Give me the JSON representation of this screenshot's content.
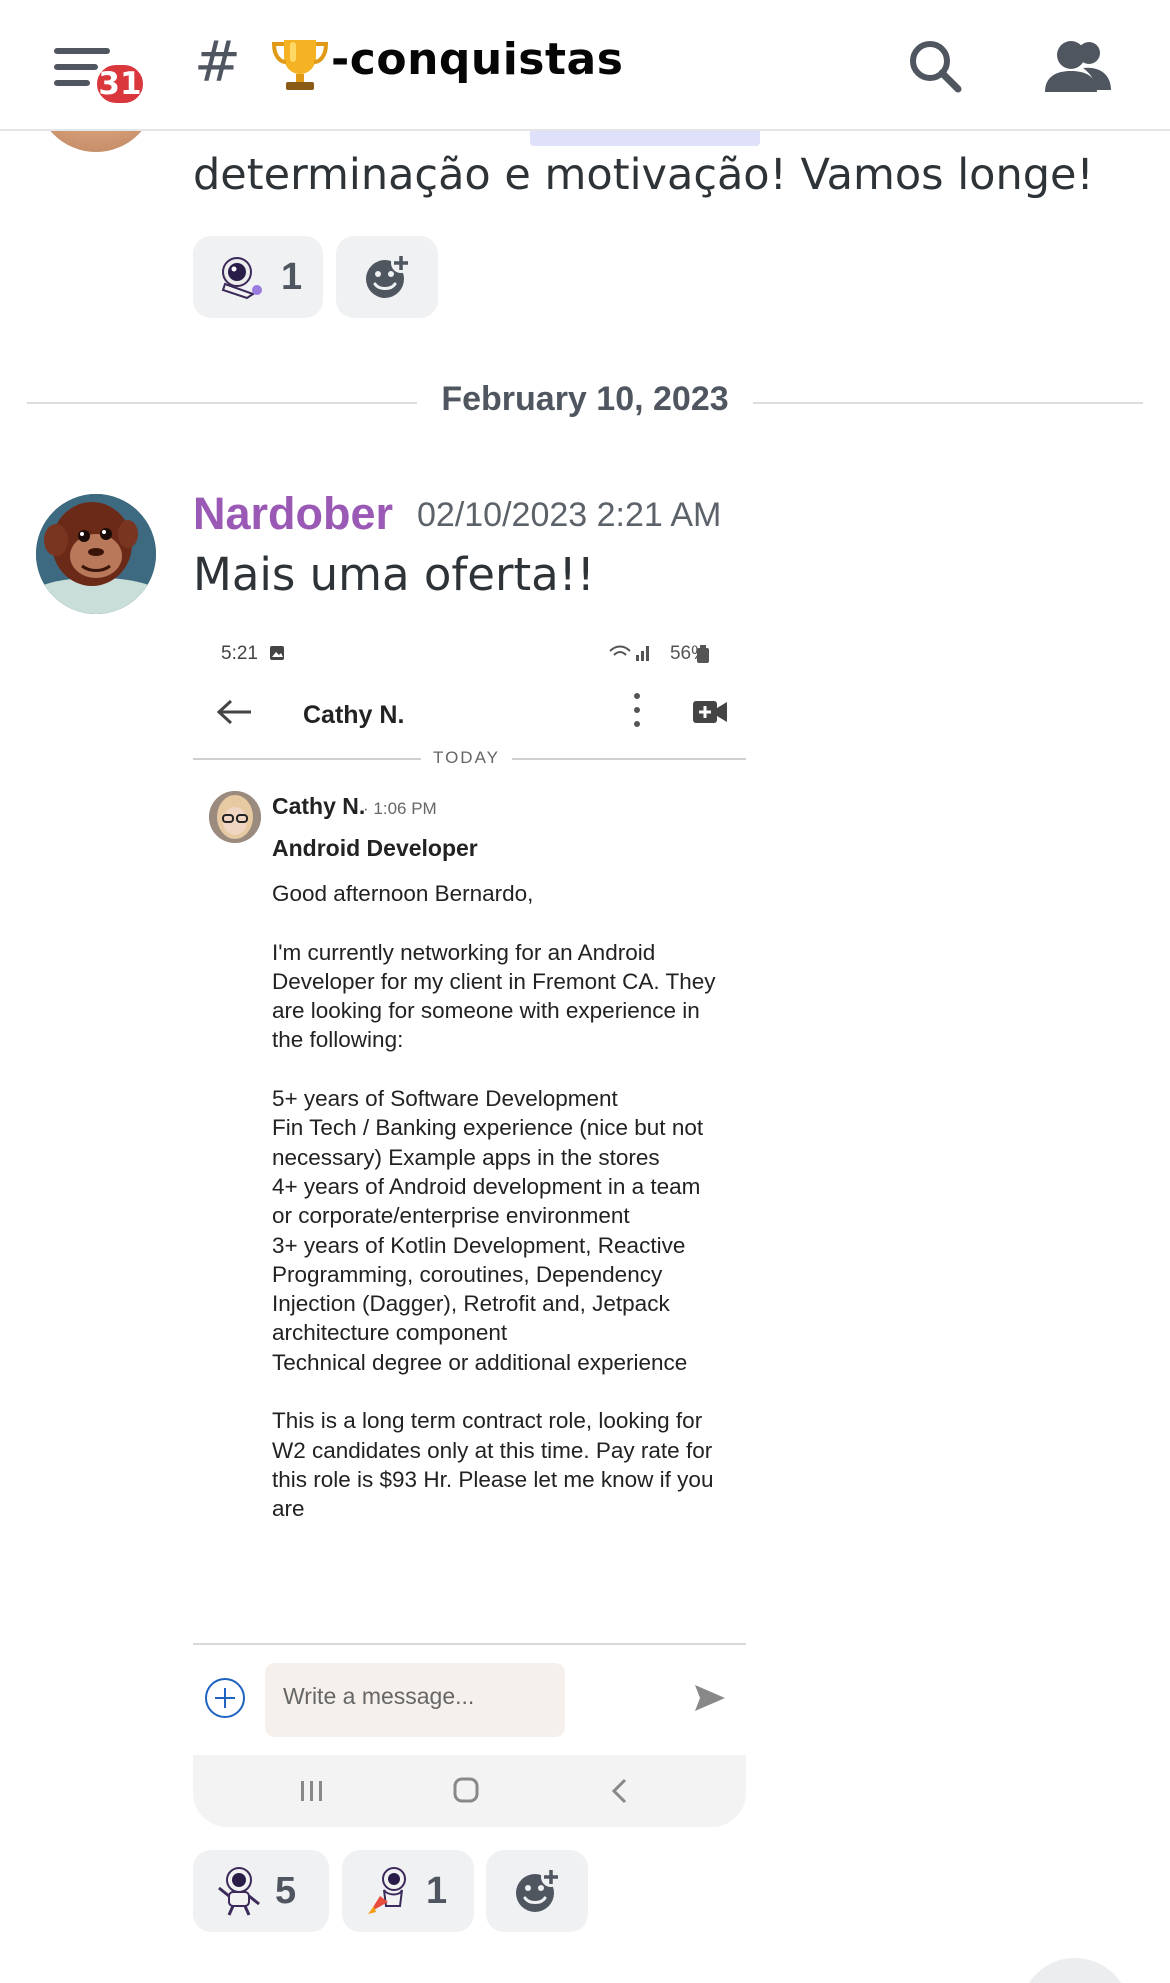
{
  "header": {
    "notification_count": "31",
    "hash_symbol": "#",
    "channel_name": "-conquistas",
    "icons": [
      "menu-icon",
      "trophy-icon",
      "search-icon",
      "members-icon"
    ]
  },
  "previous_message": {
    "text": "determinação e motivação! Vamos longe!",
    "reactions": [
      {
        "icon": "astronaut-emoji-icon",
        "count": "1"
      }
    ]
  },
  "date_divider": "February 10, 2023",
  "message": {
    "author": "Nardober",
    "timestamp": "02/10/2023 2:21 AM",
    "text": "Mais uma oferta!!",
    "author_color": "#9b59b6",
    "attachment": {
      "status_time": "5:21",
      "status_battery": "56%",
      "contact_name": "Cathy N.",
      "today_label": "TODAY",
      "sender_name": "Cathy N.",
      "sender_time": "1:06 PM",
      "subject": "Android Developer",
      "body": "Good afternoon Bernardo,\n\nI'm currently networking for an Android Developer for my client in Fremont CA. They are looking for someone with experience in the following:\n\n 5+ years of Software Development\nFin Tech / Banking experience (nice but not necessary) Example apps in the stores\n4+ years of Android development in a team or corporate/enterprise environment\n3+ years of Kotlin Development, Reactive Programming, coroutines, Dependency Injection (Dagger), Retrofit and, Jetpack architecture component\nTechnical degree or additional experience\n\nThis is a long term contract role, looking for W2 candidates only at this time.  Pay rate for this role is $93 Hr.  Please let me know if you are",
      "input_placeholder": "Write a message..."
    },
    "reactions": [
      {
        "icon": "astronaut-emoji-icon",
        "count": "5"
      },
      {
        "icon": "astronaut-rocket-emoji-icon",
        "count": "1"
      }
    ]
  }
}
